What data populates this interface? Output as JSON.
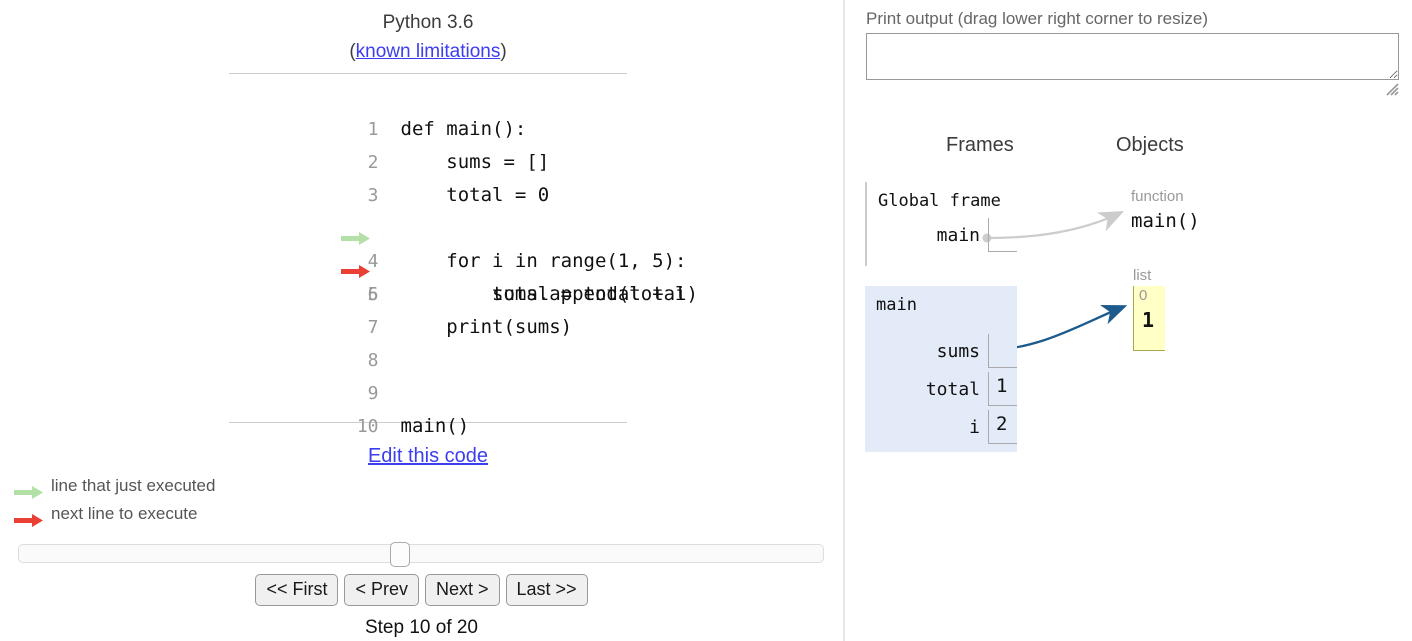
{
  "colors": {
    "executed_arrow": "#b3e0a6",
    "next_arrow": "#e93f34",
    "frame_highlight": "#e2ebf7",
    "list_bg": "#ffffc6",
    "pointer_blue": "#1c5b8c",
    "pointer_gray": "#cccccc",
    "link": "#3d3df0"
  },
  "code_panel": {
    "python_version": "Python 3.6",
    "limitations_prefix": "(",
    "limitations_link": "known limitations",
    "limitations_suffix": ")",
    "edit_link": "Edit this code",
    "lines": [
      {
        "n": "1",
        "text": "def main():",
        "arrow": "none"
      },
      {
        "n": "2",
        "text": "    sums = []",
        "arrow": "none"
      },
      {
        "n": "3",
        "text": "    total = 0",
        "arrow": "none"
      },
      {
        "n": "4",
        "text": "    for i in range(1, 5):",
        "arrow": "executed"
      },
      {
        "n": "5",
        "text": "        total = total + i",
        "arrow": "next"
      },
      {
        "n": "6",
        "text": "        sums.append(total)",
        "arrow": "none"
      },
      {
        "n": "7",
        "text": "    print(sums)",
        "arrow": "none"
      },
      {
        "n": "8",
        "text": "",
        "arrow": "none"
      },
      {
        "n": "9",
        "text": "",
        "arrow": "none"
      },
      {
        "n": "10",
        "text": "main()",
        "arrow": "none"
      }
    ]
  },
  "legend": {
    "executed": "line that just executed",
    "next": "next line to execute"
  },
  "controls": {
    "slider_value": 10,
    "slider_min": 1,
    "slider_max": 20,
    "buttons": [
      {
        "label": "<< First",
        "name": "first-button"
      },
      {
        "label": "< Prev",
        "name": "prev-button"
      },
      {
        "label": "Next >",
        "name": "next-button"
      },
      {
        "label": "Last >>",
        "name": "last-button"
      }
    ],
    "step_label": "Step 10 of 20"
  },
  "print_output": {
    "label": "Print output (drag lower right corner to resize)",
    "value": "",
    "placeholder": ""
  },
  "viz": {
    "frames_header": "Frames",
    "objects_header": "Objects",
    "frames": [
      {
        "title": "Global frame",
        "highlighted": false,
        "vars": [
          {
            "name": "main",
            "value": "",
            "is_pointer": true
          }
        ]
      },
      {
        "title": "main",
        "highlighted": true,
        "vars": [
          {
            "name": "sums",
            "value": "",
            "is_pointer": true
          },
          {
            "name": "total",
            "value": "1",
            "is_pointer": false
          },
          {
            "name": "i",
            "value": "2",
            "is_pointer": false
          }
        ]
      }
    ],
    "objects": [
      {
        "type_label": "function",
        "name": "main()"
      },
      {
        "type_label": "list",
        "elements": [
          {
            "index": "0",
            "value": "1"
          }
        ]
      }
    ]
  }
}
